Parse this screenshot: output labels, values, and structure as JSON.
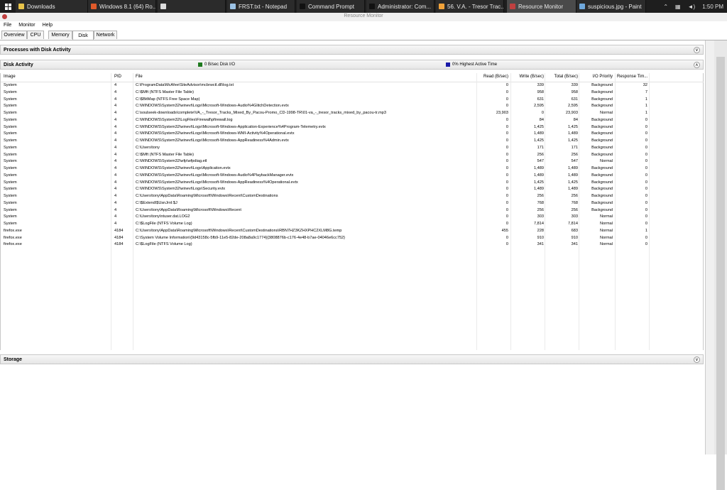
{
  "taskbar": {
    "items": [
      {
        "label": "Downloads",
        "color": "#e8c34a"
      },
      {
        "label": "Windows 8.1 (64) Ro...",
        "color": "#e05a2a"
      },
      {
        "label": "",
        "color": "#dddddd"
      },
      {
        "label": "FRST.txt - Notepad",
        "color": "#9cc3e6"
      },
      {
        "label": "Command Prompt",
        "color": "#111111"
      },
      {
        "label": "Administrator: Com...",
        "color": "#111111"
      },
      {
        "label": "56. V.A. - Tresor Trac...",
        "color": "#f2a33a"
      },
      {
        "label": "Resource Monitor",
        "color": "#c04040"
      },
      {
        "label": "suspicious.jpg - Paint",
        "color": "#6fa8dc"
      }
    ],
    "clock": "1:50 PM"
  },
  "window": {
    "title": "Resource Monitor"
  },
  "menu": [
    "File",
    "Monitor",
    "Help"
  ],
  "tabs": [
    "Overview",
    "CPU",
    "Memory",
    "Disk",
    "Network"
  ],
  "sections": {
    "processes": "Processes with Disk Activity",
    "disk": "Disk Activity",
    "storage": "Storage",
    "disk_io": "0 B/sec Disk I/O",
    "active_time": "0% Highest Active Time"
  },
  "colors": {
    "disk_io": "#1f7a1f",
    "active_time": "#1a1aa8"
  },
  "columns": [
    "Image",
    "PID",
    "File",
    "Read (B/sec)",
    "Write (B/sec)",
    "Total (B/sec)",
    "I/O Priority",
    "Response Tim..."
  ],
  "rows": [
    [
      "System",
      "4",
      "C:\\ProgramData\\McAfee\\SiteAdvisor\\mcbrwctl.dll\\log.txt",
      "0",
      "339",
      "339",
      "Background",
      "32"
    ],
    [
      "System",
      "4",
      "C:\\$Mft (NTFS Master File Table)",
      "0",
      "958",
      "958",
      "Background",
      "7"
    ],
    [
      "System",
      "4",
      "C:\\$BitMap (NTFS Free Space Map)",
      "0",
      "631",
      "631",
      "Background",
      "1"
    ],
    [
      "System",
      "4",
      "C:\\WINDOWS\\System32\\winevt\\Logs\\Microsoft-Windows-Audio%4GlitchDetection.evtx",
      "0",
      "2,595",
      "2,595",
      "Background",
      "1"
    ],
    [
      "System",
      "4",
      "C:\\soulseek-downloads\\complete\\VA_-_Tresor_Tracks_Mixed_By_Pacou-Promo_CD-1998-TR\\01-va_-_tresor_tracks_mixed_by_pacou-tr.mp3",
      "23,903",
      "0",
      "23,903",
      "Normal",
      "1"
    ],
    [
      "System",
      "4",
      "C:\\WINDOWS\\System32\\LogFiles\\Firewall\\pfirewall.log",
      "0",
      "84",
      "84",
      "Background",
      "0"
    ],
    [
      "System",
      "4",
      "C:\\WINDOWS\\System32\\winevt\\Logs\\Microsoft-Windows-Application-Experience%4Program-Telemetry.evtx",
      "0",
      "1,425",
      "1,425",
      "Background",
      "0"
    ],
    [
      "System",
      "4",
      "C:\\WINDOWS\\System32\\winevt\\Logs\\Microsoft-Windows-WMI-Activity%4Operational.evtx",
      "0",
      "1,489",
      "1,489",
      "Background",
      "0"
    ],
    [
      "System",
      "4",
      "C:\\WINDOWS\\System32\\winevt\\Logs\\Microsoft-Windows-AppReadiness%4Admin.evtx",
      "0",
      "1,425",
      "1,425",
      "Background",
      "0"
    ],
    [
      "System",
      "4",
      "C:\\Users\\tony",
      "0",
      "171",
      "171",
      "Background",
      "0"
    ],
    [
      "System",
      "4",
      "C:\\$Mft (NTFS Master File Table)",
      "0",
      "256",
      "256",
      "Background",
      "0"
    ],
    [
      "System",
      "4",
      "C:\\WINDOWS\\System32\\wfp\\wfpdiag.etl",
      "0",
      "547",
      "547",
      "Normal",
      "0"
    ],
    [
      "System",
      "4",
      "C:\\WINDOWS\\System32\\winevt\\Logs\\Application.evtx",
      "0",
      "1,489",
      "1,489",
      "Background",
      "0"
    ],
    [
      "System",
      "4",
      "C:\\WINDOWS\\System32\\winevt\\Logs\\Microsoft-Windows-Audio%4PlaybackManager.evtx",
      "0",
      "1,489",
      "1,489",
      "Background",
      "0"
    ],
    [
      "System",
      "4",
      "C:\\WINDOWS\\System32\\winevt\\Logs\\Microsoft-Windows-AppReadiness%4Operational.evtx",
      "0",
      "1,425",
      "1,425",
      "Background",
      "0"
    ],
    [
      "System",
      "4",
      "C:\\WINDOWS\\System32\\winevt\\Logs\\Security.evtx",
      "0",
      "1,489",
      "1,489",
      "Background",
      "0"
    ],
    [
      "System",
      "4",
      "C:\\Users\\tony\\AppData\\Roaming\\Microsoft\\Windows\\Recent\\CustomDestinations",
      "0",
      "256",
      "256",
      "Background",
      "0"
    ],
    [
      "System",
      "4",
      "C:\\$Extend\\$UsnJrnl:$J",
      "0",
      "768",
      "768",
      "Background",
      "0"
    ],
    [
      "System",
      "4",
      "C:\\Users\\tony\\AppData\\Roaming\\Microsoft\\Windows\\Recent",
      "0",
      "256",
      "256",
      "Background",
      "0"
    ],
    [
      "System",
      "4",
      "C:\\Users\\tony\\ntuser.dat.LOG2",
      "0",
      "303",
      "303",
      "Normal",
      "0"
    ],
    [
      "System",
      "4",
      "C:\\$LogFile (NTFS Volume Log)",
      "0",
      "7,814",
      "7,814",
      "Normal",
      "0"
    ],
    [
      "firefox.exe",
      "4184",
      "C:\\Users\\tony\\AppData\\Roaming\\Microsoft\\Windows\\Recent\\CustomDestinations\\RBN7HZ3KZHXPHC2XLM8G.temp",
      "455",
      "228",
      "683",
      "Normal",
      "1"
    ],
    [
      "firefox.exe",
      "4184",
      "C:\\System Volume Information\\{9d43158c-5fb9-11e5-82de-208a8a9c1774}{3808876b-c176-4e48-b7ae-04046e6cc752}",
      "0",
      "910",
      "910",
      "Normal",
      "0"
    ],
    [
      "firefox.exe",
      "4184",
      "C:\\$LogFile (NTFS Volume Log)",
      "0",
      "341",
      "341",
      "Normal",
      "0"
    ]
  ]
}
